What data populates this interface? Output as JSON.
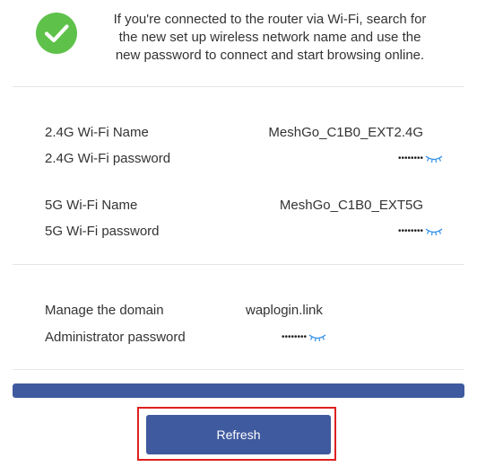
{
  "message": {
    "line1": "If you're connected to the router via Wi-Fi, search for",
    "line2": "the new set up wireless network name and use the",
    "line3": "new password to connect and start browsing online."
  },
  "wifi_2g": {
    "name_label": "2.4G Wi-Fi Name",
    "name_value": "MeshGo_C1B0_EXT2.4G",
    "password_label": "2.4G Wi-Fi password",
    "password_mask": "••••••••"
  },
  "wifi_5g": {
    "name_label": "5G Wi-Fi Name",
    "name_value": "MeshGo_C1B0_EXT5G",
    "password_label": "5G Wi-Fi password",
    "password_mask": "••••••••"
  },
  "admin": {
    "domain_label": "Manage the domain",
    "domain_value": "waplogin.link",
    "password_label": "Administrator password",
    "password_mask": "••••••••"
  },
  "progress": {
    "percent": 100
  },
  "refresh_label": "Refresh",
  "icons": {
    "success": "check-circle-icon",
    "show_password": "eye-closed-icon"
  },
  "colors": {
    "success": "#5ec24a",
    "primary": "#3f5a9e",
    "highlight": "#e02020",
    "eye": "#2f8ee8"
  }
}
